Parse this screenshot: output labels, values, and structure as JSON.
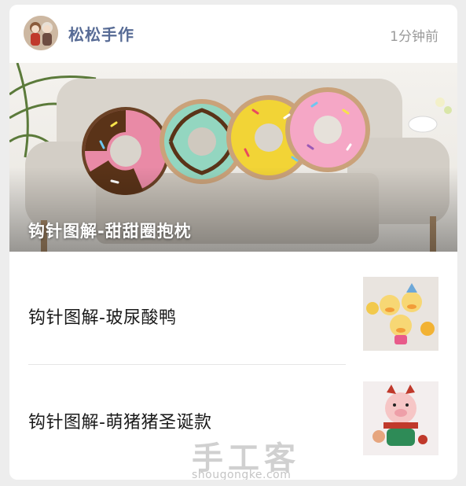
{
  "header": {
    "account_name": "松松手作",
    "time": "1分钟前",
    "avatar_icon": "crochet-dolls-avatar"
  },
  "hero": {
    "title": "钩针图解-甜甜圈抱枕"
  },
  "articles": [
    {
      "title": "钩针图解-玻尿酸鸭",
      "thumb_icon": "crochet-ducks-thumbnail"
    },
    {
      "title": "钩针图解-萌猪猪圣诞款",
      "thumb_icon": "crochet-pig-thumbnail"
    }
  ],
  "watermark": {
    "cn": "手工客",
    "en": "shougongke.com"
  },
  "colors": {
    "link_blue": "#576b95",
    "time_gray": "#9a9a9a"
  }
}
